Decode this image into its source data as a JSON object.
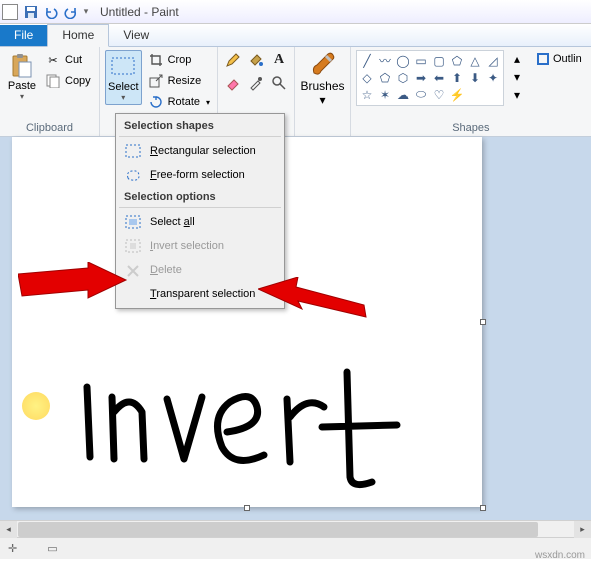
{
  "title": "Untitled - Paint",
  "tabs": {
    "file": "File",
    "home": "Home",
    "view": "View"
  },
  "groups": {
    "clipboard": "Clipboard",
    "shapes": "Shapes"
  },
  "clipboard": {
    "paste": "Paste",
    "cut": "Cut",
    "copy": "Copy"
  },
  "image": {
    "select": "Select",
    "crop": "Crop",
    "resize": "Resize",
    "rotate": "Rotate"
  },
  "tools": {
    "brushes": "Brushes"
  },
  "shapes": {
    "outline": "Outlin"
  },
  "menu": {
    "shapes_header": "Selection shapes",
    "rectangular": "Rectangular selection",
    "freeform": "Free-form selection",
    "options_header": "Selection options",
    "select_all": "Select all",
    "invert": "Invert selection",
    "delete": "Delete",
    "transparent": "Transparent selection"
  },
  "canvas_text": "Invert",
  "watermark": "wsxdn.com"
}
